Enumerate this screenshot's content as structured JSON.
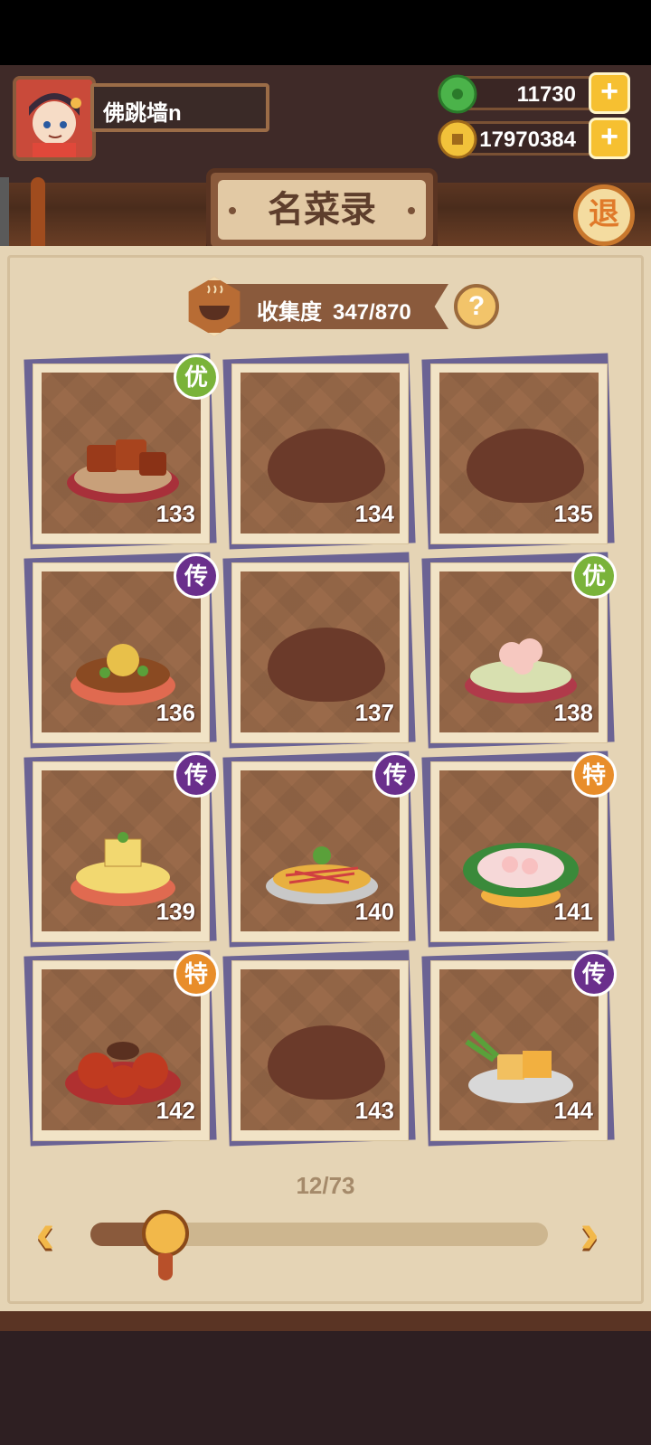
{
  "player": {
    "name": "佛跳墙n"
  },
  "currency": {
    "jade": {
      "value": "11730",
      "icon": "jade-coin-icon"
    },
    "gold": {
      "value": "17970384",
      "icon": "gold-coin-icon"
    }
  },
  "title": "名菜录",
  "exit_label": "退",
  "collection": {
    "label": "收集度",
    "value": "347/870"
  },
  "help_label": "?",
  "cards": [
    {
      "num": "133",
      "badge": "优",
      "badge_type": "you",
      "collected": true,
      "dish": "braised-pork"
    },
    {
      "num": "134",
      "badge": "",
      "badge_type": "",
      "collected": false
    },
    {
      "num": "135",
      "badge": "",
      "badge_type": "",
      "collected": false
    },
    {
      "num": "136",
      "badge": "传",
      "badge_type": "chuan",
      "collected": true,
      "dish": "noodle-bowl"
    },
    {
      "num": "137",
      "badge": "",
      "badge_type": "",
      "collected": false
    },
    {
      "num": "138",
      "badge": "优",
      "badge_type": "you",
      "collected": true,
      "dish": "shrimp-noodles"
    },
    {
      "num": "139",
      "badge": "传",
      "badge_type": "chuan",
      "collected": true,
      "dish": "egg-cake"
    },
    {
      "num": "140",
      "badge": "传",
      "badge_type": "chuan",
      "collected": true,
      "dish": "cold-noodles"
    },
    {
      "num": "141",
      "badge": "特",
      "badge_type": "te",
      "collected": true,
      "dish": "shrimp-leaf"
    },
    {
      "num": "142",
      "badge": "特",
      "badge_type": "te",
      "collected": true,
      "dish": "crab-plate"
    },
    {
      "num": "143",
      "badge": "",
      "badge_type": "",
      "collected": false
    },
    {
      "num": "144",
      "badge": "传",
      "badge_type": "chuan",
      "collected": true,
      "dish": "tofu-plate"
    }
  ],
  "page": {
    "label": "12/73",
    "progress": 0.164
  },
  "colors": {
    "accent": "#f2b84a",
    "badge_you": "#7ab33a",
    "badge_chuan": "#6a2f8c",
    "badge_te": "#e88d2a"
  }
}
